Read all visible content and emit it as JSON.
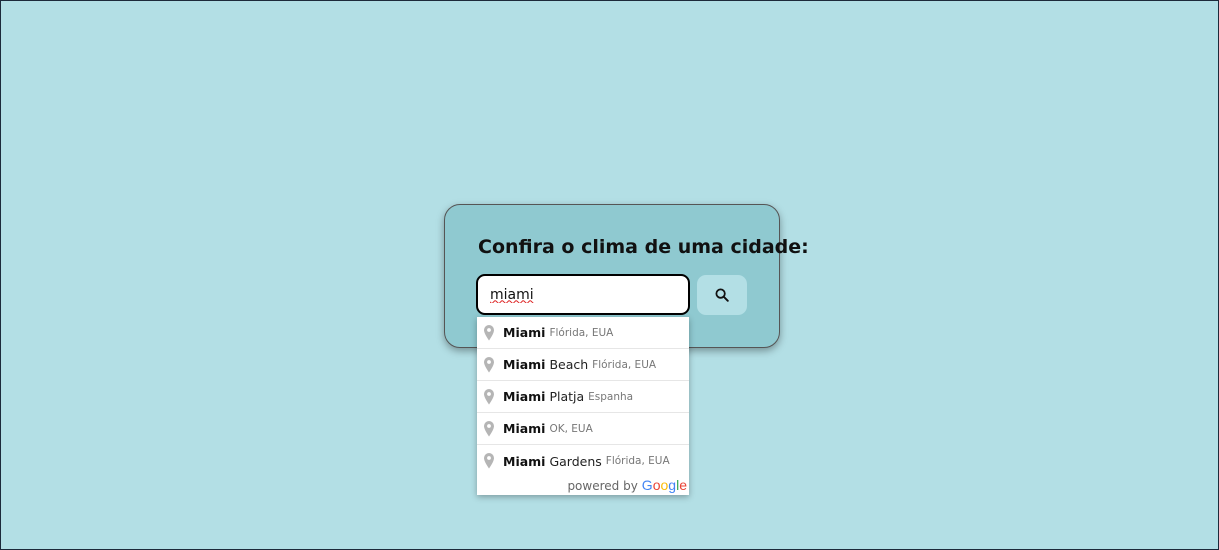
{
  "card": {
    "title": "Confira o clima de uma cidade:",
    "search_value": "miami",
    "search_button_icon": "search-icon"
  },
  "autocomplete": {
    "suggestions": [
      {
        "match": "Miami",
        "rest": "",
        "secondary": "Flórida, EUA"
      },
      {
        "match": "Miami",
        "rest": " Beach",
        "secondary": "Flórida, EUA"
      },
      {
        "match": "Miami",
        "rest": " Platja",
        "secondary": "Espanha"
      },
      {
        "match": "Miami",
        "rest": "",
        "secondary": "OK, EUA"
      },
      {
        "match": "Miami",
        "rest": " Gardens",
        "secondary": "Flórida, EUA"
      }
    ],
    "powered_by": "powered by",
    "logo_text": "Google",
    "pin_icon": "map-pin-icon"
  },
  "colors": {
    "background": "#b3dfe5",
    "card": "#8fc9d0",
    "button": "#b3dfe5"
  }
}
